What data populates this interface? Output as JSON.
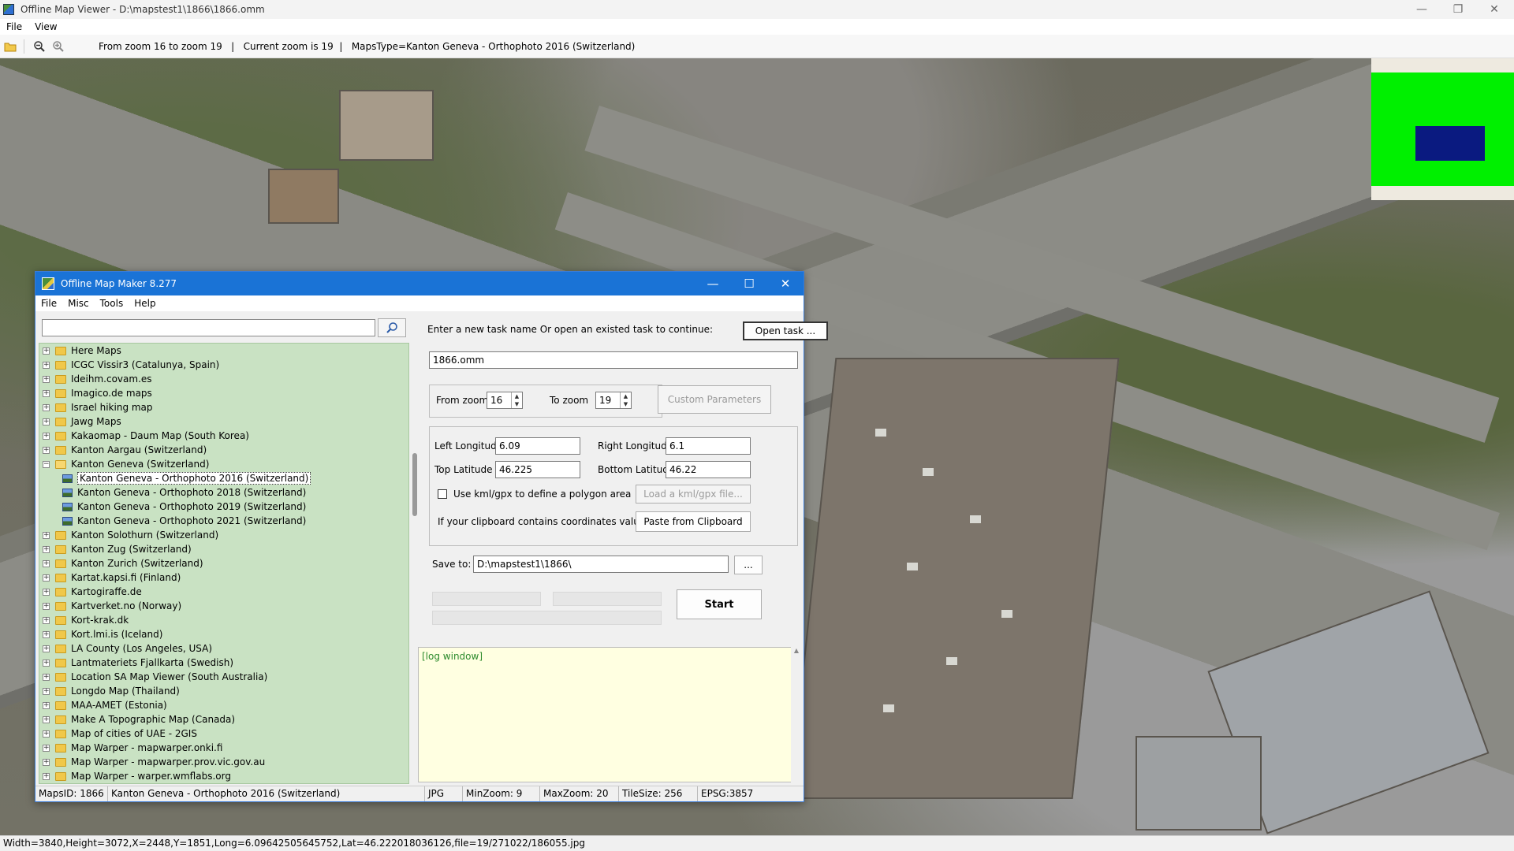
{
  "app": {
    "title": "Offline Map Viewer - D:\\mapstest1\\1866\\1866.omm",
    "menu": [
      "File",
      "View"
    ],
    "toolbar_status": "From zoom 16 to zoom 19   |   Current zoom is 19  |   MapsType=Kanton Geneva - Orthophoto 2016 (Switzerland)",
    "window_controls": {
      "minimize": "—",
      "restore": "❐",
      "close": "✕"
    },
    "statusbar": "Width=3840,Height=3072,X=2448,Y=1851,Long=6.09642505645752,Lat=46.222018036126,file=19/271022/186055.jpg",
    "colors": {
      "minimap_green": "#00f000",
      "minimap_view": "#0a1a80",
      "dialog_title": "#1a73d6"
    }
  },
  "dialog": {
    "title": "Offline Map Maker 8.277",
    "menu": [
      "File",
      "Misc",
      "Tools",
      "Help"
    ],
    "window_controls": {
      "minimize": "—",
      "maximize": "☐",
      "close": "✕"
    },
    "search": {
      "value": "",
      "icon": "search-icon"
    },
    "tree": [
      {
        "label": "Here Maps",
        "type": "folder"
      },
      {
        "label": "ICGC Vissir3 (Catalunya, Spain)",
        "type": "folder"
      },
      {
        "label": "Ideihm.covam.es",
        "type": "folder"
      },
      {
        "label": "Imagico.de maps",
        "type": "folder"
      },
      {
        "label": "Israel hiking map",
        "type": "folder"
      },
      {
        "label": "Jawg Maps",
        "type": "folder"
      },
      {
        "label": "Kakaomap - Daum Map (South Korea)",
        "type": "folder"
      },
      {
        "label": "Kanton Aargau (Switzerland)",
        "type": "folder"
      },
      {
        "label": "Kanton Geneva (Switzerland)",
        "type": "folder-open"
      },
      {
        "label": "Kanton Geneva - Orthophoto 2016 (Switzerland)",
        "type": "map",
        "selected": true
      },
      {
        "label": "Kanton Geneva - Orthophoto 2018 (Switzerland)",
        "type": "map"
      },
      {
        "label": "Kanton Geneva - Orthophoto 2019 (Switzerland)",
        "type": "map"
      },
      {
        "label": "Kanton Geneva - Orthophoto 2021 (Switzerland)",
        "type": "map"
      },
      {
        "label": "Kanton Solothurn (Switzerland)",
        "type": "folder"
      },
      {
        "label": "Kanton Zug (Switzerland)",
        "type": "folder"
      },
      {
        "label": "Kanton Zurich (Switzerland)",
        "type": "folder"
      },
      {
        "label": "Kartat.kapsi.fi (Finland)",
        "type": "folder"
      },
      {
        "label": "Kartogiraffe.de",
        "type": "folder"
      },
      {
        "label": "Kartverket.no (Norway)",
        "type": "folder"
      },
      {
        "label": "Kort-krak.dk",
        "type": "folder"
      },
      {
        "label": "Kort.lmi.is (Iceland)",
        "type": "folder"
      },
      {
        "label": "LA County (Los Angeles, USA)",
        "type": "folder"
      },
      {
        "label": "Lantmateriets Fjallkarta (Swedish)",
        "type": "folder"
      },
      {
        "label": "Location SA Map Viewer (South Australia)",
        "type": "folder"
      },
      {
        "label": "Longdo Map (Thailand)",
        "type": "folder"
      },
      {
        "label": "MAA-AMET (Estonia)",
        "type": "folder"
      },
      {
        "label": "Make A Topographic Map (Canada)",
        "type": "folder"
      },
      {
        "label": "Map of cities of UAE - 2GIS",
        "type": "folder"
      },
      {
        "label": "Map Warper - mapwarper.onki.fi",
        "type": "folder"
      },
      {
        "label": "Map Warper - mapwarper.prov.vic.gov.au",
        "type": "folder"
      },
      {
        "label": "Map Warper - warper.wmflabs.org",
        "type": "folder"
      }
    ],
    "task_prompt": "Enter a new task name Or open an existed task to continue:",
    "open_task_label": "Open task ...",
    "task_name": "1866.omm",
    "from_zoom_label": "From zoom",
    "from_zoom": "16",
    "to_zoom_label": "To zoom",
    "to_zoom": "19",
    "custom_params_label": "Custom Parameters",
    "left_lon_label": "Left Longitude",
    "left_lon": "6.09",
    "right_lon_label": "Right Longitude",
    "right_lon": "6.1",
    "top_lat_label": "Top Latitude",
    "top_lat": "46.225",
    "bottom_lat_label": "Bottom Latitude",
    "bottom_lat": "46.22",
    "kml_checkbox_label": "Use kml/gpx to define a polygon area",
    "kml_checked": false,
    "load_kml_label": "Load a kml/gpx file...",
    "clipboard_prompt": "If your clipboard contains coordinates values:",
    "paste_label": "Paste from Clipboard",
    "save_to_label": "Save to:",
    "save_to": "D:\\mapstest1\\1866\\",
    "browse_label": "...",
    "start_label": "Start",
    "log_text": "[log window]",
    "status": {
      "maps_id": "MapsID: 1866",
      "map_name": "Kanton Geneva - Orthophoto 2016 (Switzerland)",
      "format": "JPG",
      "min_zoom": "MinZoom: 9",
      "max_zoom": "MaxZoom: 20",
      "tile_size": "TileSize: 256",
      "epsg": "EPSG:3857"
    }
  }
}
